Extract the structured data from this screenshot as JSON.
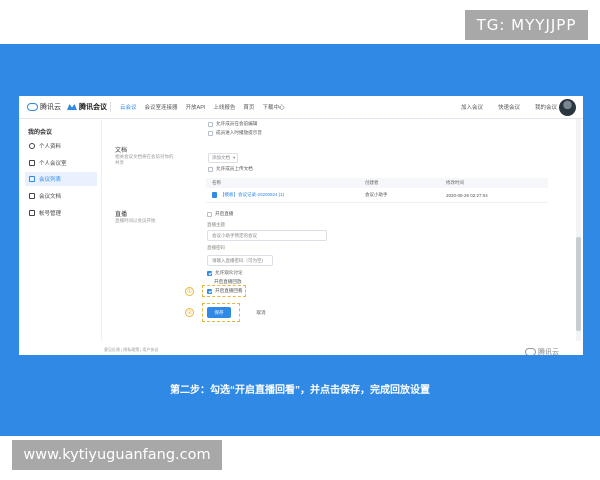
{
  "watermark_top": "TG: MYYJJPP",
  "watermark_bottom": "www.kytiyuguanfang.com",
  "caption": "第二步：勾选“开启直播回看”，并点击保存，完成回放设置",
  "colors": {
    "background_blue": "#2f89e5",
    "accent": "#2f89e5",
    "highlight": "#e6b93c"
  },
  "screen": {
    "topnav": {
      "logo_cloud": "腾讯云",
      "logo_meeting": "腾讯会议",
      "links": [
        "云会议",
        "会议室连接器",
        "开放API",
        "上线报告",
        "首页",
        "下载中心"
      ],
      "active_link_index": 0,
      "right_links": [
        "加入会议",
        "快速会议",
        "我的会议"
      ]
    },
    "sidebar": {
      "heading": "我的会议",
      "items": [
        {
          "label": "个人资料",
          "icon": "user-icon"
        },
        {
          "label": "个人会议室",
          "icon": "room-icon"
        },
        {
          "label": "会议列表",
          "icon": "list-icon",
          "active": true
        },
        {
          "label": "会议文档",
          "icon": "doc-icon"
        },
        {
          "label": "帐号管理",
          "icon": "account-icon"
        }
      ]
    },
    "top_checkboxes": [
      {
        "label": "允许成员在会前编辑",
        "checked": false
      },
      {
        "label": "成员进入时播放提示音",
        "checked": false
      }
    ],
    "documents": {
      "title": "文档",
      "subtitle": "相关会议文档将在会前对你的共享",
      "select_placeholder": "添加文档",
      "allow_upload_label": "允许成员上传文档",
      "columns": [
        "名称",
        "创建者",
        "修改时间"
      ],
      "rows": [
        {
          "name": "【模板】会议记录-20200824 (1)",
          "creator": "会议小助手",
          "modified": "2020-08-26 02:27:04"
        }
      ]
    },
    "live": {
      "title": "直播",
      "subtitle": "直播时间以会议开始",
      "enable_label": "开启直播",
      "topic_label": "直播主题",
      "topic_value": "会议小助手预定的会议",
      "password_label": "直播密码",
      "password_placeholder": "请输入直播密码（可为空)",
      "options": [
        {
          "label": "允许观众讨论",
          "checked": true
        },
        {
          "label": "开启直播回放",
          "checked": false
        },
        {
          "label": "开启直播回看",
          "checked": true
        }
      ]
    },
    "markers": [
      "①",
      "②"
    ],
    "save_label": "保存",
    "cancel_label": "取消",
    "footer_links": "意见反馈 | 隐私政策 | 用户协议",
    "footer_logo": "腾讯云"
  }
}
